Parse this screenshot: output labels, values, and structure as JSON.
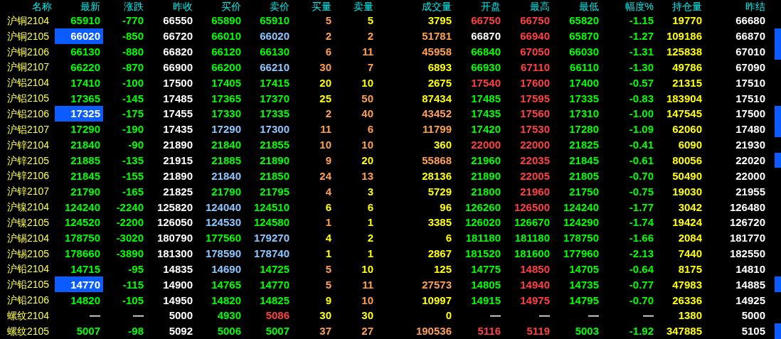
{
  "columns": [
    "名称",
    "最新",
    "涨跌",
    "昨收",
    "买价",
    "卖价",
    "买量",
    "卖量",
    "成交量",
    "开盘",
    "最高",
    "最低",
    "幅度%",
    "持仓量",
    "昨结"
  ],
  "rows": [
    {
      "name": "沪铜2104",
      "highlighted": false,
      "marked": false,
      "cells": [
        {
          "text": "65910",
          "color": "#00ff00"
        },
        {
          "text": "-770",
          "color": "#00ff00"
        },
        {
          "text": "66550",
          "color": "#ffffff"
        },
        {
          "text": "65890",
          "color": "#00ff00"
        },
        {
          "text": "65910",
          "color": "#00ff00"
        },
        {
          "text": "5",
          "color": "#ffa050"
        },
        {
          "text": "5",
          "color": "#ffff00"
        },
        {
          "text": "3795",
          "color": "#ffff00"
        },
        {
          "text": "66750",
          "color": "#ff4040"
        },
        {
          "text": "66750",
          "color": "#ff4040"
        },
        {
          "text": "65820",
          "color": "#00ff00"
        },
        {
          "text": "-1.15",
          "color": "#00ff00"
        },
        {
          "text": "19770",
          "color": "#ffff00"
        },
        {
          "text": "66680",
          "color": "#ffffff"
        }
      ]
    },
    {
      "name": "沪铜2105",
      "highlighted": true,
      "marked": true,
      "cells": [
        {
          "text": "66020",
          "color": "#ffffff"
        },
        {
          "text": "-850",
          "color": "#00ff00"
        },
        {
          "text": "66720",
          "color": "#ffffff"
        },
        {
          "text": "66010",
          "color": "#00ff00"
        },
        {
          "text": "66020",
          "color": "#8cc8ff"
        },
        {
          "text": "2",
          "color": "#ffa050"
        },
        {
          "text": "2",
          "color": "#ffa050"
        },
        {
          "text": "51781",
          "color": "#ffa050"
        },
        {
          "text": "66870",
          "color": "#ffffff"
        },
        {
          "text": "66940",
          "color": "#ff4040"
        },
        {
          "text": "65870",
          "color": "#00ff00"
        },
        {
          "text": "-1.27",
          "color": "#00ff00"
        },
        {
          "text": "109186",
          "color": "#ffff00"
        },
        {
          "text": "66870",
          "color": "#ffffff"
        }
      ]
    },
    {
      "name": "沪铜2106",
      "highlighted": false,
      "marked": true,
      "cells": [
        {
          "text": "66130",
          "color": "#00ff00"
        },
        {
          "text": "-880",
          "color": "#00ff00"
        },
        {
          "text": "66820",
          "color": "#ffffff"
        },
        {
          "text": "66120",
          "color": "#00ff00"
        },
        {
          "text": "66130",
          "color": "#00ff00"
        },
        {
          "text": "6",
          "color": "#ffa050"
        },
        {
          "text": "11",
          "color": "#ffa050"
        },
        {
          "text": "45958",
          "color": "#ffa050"
        },
        {
          "text": "66840",
          "color": "#00ff00"
        },
        {
          "text": "67050",
          "color": "#ff4040"
        },
        {
          "text": "66030",
          "color": "#00ff00"
        },
        {
          "text": "-1.31",
          "color": "#00ff00"
        },
        {
          "text": "125838",
          "color": "#ffff00"
        },
        {
          "text": "67010",
          "color": "#ffffff"
        }
      ]
    },
    {
      "name": "沪铜2107",
      "highlighted": false,
      "marked": false,
      "cells": [
        {
          "text": "66220",
          "color": "#00ff00"
        },
        {
          "text": "-870",
          "color": "#00ff00"
        },
        {
          "text": "66900",
          "color": "#ffffff"
        },
        {
          "text": "66200",
          "color": "#00ff00"
        },
        {
          "text": "66210",
          "color": "#8cc8ff"
        },
        {
          "text": "30",
          "color": "#ffa050"
        },
        {
          "text": "7",
          "color": "#ffa050"
        },
        {
          "text": "6893",
          "color": "#ffff00"
        },
        {
          "text": "66930",
          "color": "#00ff00"
        },
        {
          "text": "67110",
          "color": "#ff4040"
        },
        {
          "text": "66110",
          "color": "#00ff00"
        },
        {
          "text": "-1.30",
          "color": "#00ff00"
        },
        {
          "text": "49786",
          "color": "#ffff00"
        },
        {
          "text": "67090",
          "color": "#ffffff"
        }
      ]
    },
    {
      "name": "沪铝2104",
      "highlighted": false,
      "marked": false,
      "cells": [
        {
          "text": "17410",
          "color": "#00ff00"
        },
        {
          "text": "-100",
          "color": "#00ff00"
        },
        {
          "text": "17500",
          "color": "#ffffff"
        },
        {
          "text": "17405",
          "color": "#00ff00"
        },
        {
          "text": "17415",
          "color": "#00ff00"
        },
        {
          "text": "20",
          "color": "#ffff00"
        },
        {
          "text": "10",
          "color": "#ffff00"
        },
        {
          "text": "2675",
          "color": "#ffff00"
        },
        {
          "text": "17540",
          "color": "#ff4040"
        },
        {
          "text": "17600",
          "color": "#ff4040"
        },
        {
          "text": "17400",
          "color": "#00ff00"
        },
        {
          "text": "-0.57",
          "color": "#00ff00"
        },
        {
          "text": "21315",
          "color": "#ffff00"
        },
        {
          "text": "17510",
          "color": "#ffffff"
        }
      ]
    },
    {
      "name": "沪铝2105",
      "highlighted": false,
      "marked": false,
      "cells": [
        {
          "text": "17365",
          "color": "#00ff00"
        },
        {
          "text": "-145",
          "color": "#00ff00"
        },
        {
          "text": "17485",
          "color": "#ffffff"
        },
        {
          "text": "17365",
          "color": "#00ff00"
        },
        {
          "text": "17370",
          "color": "#00ff00"
        },
        {
          "text": "25",
          "color": "#ffff00"
        },
        {
          "text": "50",
          "color": "#ffa050"
        },
        {
          "text": "87434",
          "color": "#ffff00"
        },
        {
          "text": "17485",
          "color": "#00ff00"
        },
        {
          "text": "17595",
          "color": "#ff4040"
        },
        {
          "text": "17335",
          "color": "#00ff00"
        },
        {
          "text": "-0.83",
          "color": "#00ff00"
        },
        {
          "text": "183904",
          "color": "#ffff00"
        },
        {
          "text": "17510",
          "color": "#ffffff"
        }
      ]
    },
    {
      "name": "沪铝2106",
      "highlighted": true,
      "marked": true,
      "cells": [
        {
          "text": "17325",
          "color": "#ffffff"
        },
        {
          "text": "-175",
          "color": "#00ff00"
        },
        {
          "text": "17455",
          "color": "#ffffff"
        },
        {
          "text": "17330",
          "color": "#00ff00"
        },
        {
          "text": "17335",
          "color": "#00ff00"
        },
        {
          "text": "2",
          "color": "#ffa050"
        },
        {
          "text": "40",
          "color": "#ffa050"
        },
        {
          "text": "43452",
          "color": "#ffa050"
        },
        {
          "text": "17435",
          "color": "#00ff00"
        },
        {
          "text": "17560",
          "color": "#ff4040"
        },
        {
          "text": "17310",
          "color": "#00ff00"
        },
        {
          "text": "-1.00",
          "color": "#00ff00"
        },
        {
          "text": "147545",
          "color": "#ffff00"
        },
        {
          "text": "17500",
          "color": "#ffffff"
        }
      ]
    },
    {
      "name": "沪铝2107",
      "highlighted": false,
      "marked": true,
      "cells": [
        {
          "text": "17290",
          "color": "#00ff00"
        },
        {
          "text": "-190",
          "color": "#00ff00"
        },
        {
          "text": "17435",
          "color": "#ffffff"
        },
        {
          "text": "17290",
          "color": "#8cc8ff"
        },
        {
          "text": "17300",
          "color": "#8cc8ff"
        },
        {
          "text": "11",
          "color": "#ffa050"
        },
        {
          "text": "6",
          "color": "#ffa050"
        },
        {
          "text": "11799",
          "color": "#ffa050"
        },
        {
          "text": "17420",
          "color": "#00ff00"
        },
        {
          "text": "17530",
          "color": "#ff4040"
        },
        {
          "text": "17280",
          "color": "#00ff00"
        },
        {
          "text": "-1.09",
          "color": "#00ff00"
        },
        {
          "text": "62060",
          "color": "#ffff00"
        },
        {
          "text": "17480",
          "color": "#ffffff"
        }
      ]
    },
    {
      "name": "沪锌2104",
      "highlighted": false,
      "marked": false,
      "cells": [
        {
          "text": "21840",
          "color": "#00ff00"
        },
        {
          "text": "-90",
          "color": "#00ff00"
        },
        {
          "text": "21890",
          "color": "#ffffff"
        },
        {
          "text": "21840",
          "color": "#00ff00"
        },
        {
          "text": "21855",
          "color": "#00ff00"
        },
        {
          "text": "10",
          "color": "#ffa050"
        },
        {
          "text": "10",
          "color": "#ffa050"
        },
        {
          "text": "360",
          "color": "#ffff00"
        },
        {
          "text": "22000",
          "color": "#ff4040"
        },
        {
          "text": "22000",
          "color": "#ff4040"
        },
        {
          "text": "21825",
          "color": "#00ff00"
        },
        {
          "text": "-0.41",
          "color": "#00ff00"
        },
        {
          "text": "6090",
          "color": "#ffff00"
        },
        {
          "text": "21930",
          "color": "#ffffff"
        }
      ]
    },
    {
      "name": "沪锌2105",
      "highlighted": false,
      "marked": true,
      "cells": [
        {
          "text": "21885",
          "color": "#00ff00"
        },
        {
          "text": "-135",
          "color": "#00ff00"
        },
        {
          "text": "21915",
          "color": "#ffffff"
        },
        {
          "text": "21885",
          "color": "#00ff00"
        },
        {
          "text": "21890",
          "color": "#00ff00"
        },
        {
          "text": "9",
          "color": "#ffa050"
        },
        {
          "text": "20",
          "color": "#ffff00"
        },
        {
          "text": "55868",
          "color": "#ffa050"
        },
        {
          "text": "21960",
          "color": "#00ff00"
        },
        {
          "text": "22035",
          "color": "#ff4040"
        },
        {
          "text": "21845",
          "color": "#00ff00"
        },
        {
          "text": "-0.61",
          "color": "#00ff00"
        },
        {
          "text": "80056",
          "color": "#ffff00"
        },
        {
          "text": "22020",
          "color": "#ffffff"
        }
      ]
    },
    {
      "name": "沪锌2106",
      "highlighted": false,
      "marked": false,
      "cells": [
        {
          "text": "21845",
          "color": "#00ff00"
        },
        {
          "text": "-155",
          "color": "#00ff00"
        },
        {
          "text": "21890",
          "color": "#ffffff"
        },
        {
          "text": "21840",
          "color": "#8cc8ff"
        },
        {
          "text": "21850",
          "color": "#00ff00"
        },
        {
          "text": "24",
          "color": "#ffa050"
        },
        {
          "text": "13",
          "color": "#ffa050"
        },
        {
          "text": "28136",
          "color": "#ffff00"
        },
        {
          "text": "21890",
          "color": "#00ff00"
        },
        {
          "text": "22005",
          "color": "#ff4040"
        },
        {
          "text": "21805",
          "color": "#00ff00"
        },
        {
          "text": "-0.70",
          "color": "#00ff00"
        },
        {
          "text": "50490",
          "color": "#ffff00"
        },
        {
          "text": "22000",
          "color": "#ffffff"
        }
      ]
    },
    {
      "name": "沪锌2107",
      "highlighted": false,
      "marked": false,
      "cells": [
        {
          "text": "21790",
          "color": "#00ff00"
        },
        {
          "text": "-165",
          "color": "#00ff00"
        },
        {
          "text": "21825",
          "color": "#ffffff"
        },
        {
          "text": "21790",
          "color": "#00ff00"
        },
        {
          "text": "21795",
          "color": "#00ff00"
        },
        {
          "text": "4",
          "color": "#ffa050"
        },
        {
          "text": "3",
          "color": "#ffff00"
        },
        {
          "text": "5729",
          "color": "#ffff00"
        },
        {
          "text": "21800",
          "color": "#00ff00"
        },
        {
          "text": "21960",
          "color": "#ff4040"
        },
        {
          "text": "21750",
          "color": "#00ff00"
        },
        {
          "text": "-0.75",
          "color": "#00ff00"
        },
        {
          "text": "19030",
          "color": "#ffff00"
        },
        {
          "text": "21955",
          "color": "#ffffff"
        }
      ]
    },
    {
      "name": "沪镍2104",
      "highlighted": false,
      "marked": false,
      "cells": [
        {
          "text": "124240",
          "color": "#00ff00"
        },
        {
          "text": "-2240",
          "color": "#00ff00"
        },
        {
          "text": "125820",
          "color": "#ffffff"
        },
        {
          "text": "124040",
          "color": "#8cc8ff"
        },
        {
          "text": "124510",
          "color": "#00ff00"
        },
        {
          "text": "6",
          "color": "#ffff00"
        },
        {
          "text": "6",
          "color": "#ffff00"
        },
        {
          "text": "96",
          "color": "#ffff00"
        },
        {
          "text": "126260",
          "color": "#00ff00"
        },
        {
          "text": "126500",
          "color": "#ff4040"
        },
        {
          "text": "124240",
          "color": "#00ff00"
        },
        {
          "text": "-1.77",
          "color": "#00ff00"
        },
        {
          "text": "3042",
          "color": "#ffff00"
        },
        {
          "text": "126480",
          "color": "#ffffff"
        }
      ]
    },
    {
      "name": "沪镍2105",
      "highlighted": false,
      "marked": false,
      "cells": [
        {
          "text": "124520",
          "color": "#00ff00"
        },
        {
          "text": "-2200",
          "color": "#00ff00"
        },
        {
          "text": "126050",
          "color": "#ffffff"
        },
        {
          "text": "124530",
          "color": "#8cc8ff"
        },
        {
          "text": "124580",
          "color": "#00ff00"
        },
        {
          "text": "1",
          "color": "#ffa050"
        },
        {
          "text": "1",
          "color": "#ffff00"
        },
        {
          "text": "3385",
          "color": "#ffff00"
        },
        {
          "text": "126020",
          "color": "#00ff00"
        },
        {
          "text": "126670",
          "color": "#00ff00"
        },
        {
          "text": "124290",
          "color": "#00ff00"
        },
        {
          "text": "-1.74",
          "color": "#00ff00"
        },
        {
          "text": "19424",
          "color": "#ffff00"
        },
        {
          "text": "126720",
          "color": "#ffffff"
        }
      ]
    },
    {
      "name": "沪锡2104",
      "highlighted": false,
      "marked": false,
      "cells": [
        {
          "text": "178750",
          "color": "#00ff00"
        },
        {
          "text": "-3020",
          "color": "#00ff00"
        },
        {
          "text": "180790",
          "color": "#ffffff"
        },
        {
          "text": "177560",
          "color": "#00ff00"
        },
        {
          "text": "179270",
          "color": "#8cc8ff"
        },
        {
          "text": "4",
          "color": "#ffff00"
        },
        {
          "text": "2",
          "color": "#ffff00"
        },
        {
          "text": "6",
          "color": "#ffff00"
        },
        {
          "text": "181180",
          "color": "#00ff00"
        },
        {
          "text": "181180",
          "color": "#00ff00"
        },
        {
          "text": "178750",
          "color": "#00ff00"
        },
        {
          "text": "-1.66",
          "color": "#00ff00"
        },
        {
          "text": "2084",
          "color": "#ffff00"
        },
        {
          "text": "181770",
          "color": "#ffffff"
        }
      ]
    },
    {
      "name": "沪锡2105",
      "highlighted": false,
      "marked": false,
      "cells": [
        {
          "text": "178660",
          "color": "#00ff00"
        },
        {
          "text": "-3890",
          "color": "#00ff00"
        },
        {
          "text": "181300",
          "color": "#ffffff"
        },
        {
          "text": "178590",
          "color": "#8cc8ff"
        },
        {
          "text": "178740",
          "color": "#8cc8ff"
        },
        {
          "text": "1",
          "color": "#ffff00"
        },
        {
          "text": "1",
          "color": "#ffff00"
        },
        {
          "text": "2867",
          "color": "#ffff00"
        },
        {
          "text": "181520",
          "color": "#00ff00"
        },
        {
          "text": "181600",
          "color": "#00ff00"
        },
        {
          "text": "177960",
          "color": "#00ff00"
        },
        {
          "text": "-2.13",
          "color": "#00ff00"
        },
        {
          "text": "7440",
          "color": "#ffff00"
        },
        {
          "text": "182550",
          "color": "#ffffff"
        }
      ]
    },
    {
      "name": "沪铅2104",
      "highlighted": false,
      "marked": false,
      "cells": [
        {
          "text": "14715",
          "color": "#00ff00"
        },
        {
          "text": "-95",
          "color": "#00ff00"
        },
        {
          "text": "14835",
          "color": "#ffffff"
        },
        {
          "text": "14690",
          "color": "#8cc8ff"
        },
        {
          "text": "14725",
          "color": "#00ff00"
        },
        {
          "text": "5",
          "color": "#ffa050"
        },
        {
          "text": "10",
          "color": "#ffff00"
        },
        {
          "text": "125",
          "color": "#ffff00"
        },
        {
          "text": "14775",
          "color": "#00ff00"
        },
        {
          "text": "14850",
          "color": "#ff4040"
        },
        {
          "text": "14705",
          "color": "#00ff00"
        },
        {
          "text": "-0.64",
          "color": "#00ff00"
        },
        {
          "text": "8175",
          "color": "#ffff00"
        },
        {
          "text": "14810",
          "color": "#ffffff"
        }
      ]
    },
    {
      "name": "沪铅2105",
      "highlighted": true,
      "marked": true,
      "cells": [
        {
          "text": "14770",
          "color": "#ffffff"
        },
        {
          "text": "-115",
          "color": "#00ff00"
        },
        {
          "text": "14900",
          "color": "#ffffff"
        },
        {
          "text": "14765",
          "color": "#00ff00"
        },
        {
          "text": "14770",
          "color": "#00ff00"
        },
        {
          "text": "5",
          "color": "#ffa050"
        },
        {
          "text": "11",
          "color": "#ffa050"
        },
        {
          "text": "27573",
          "color": "#ffa050"
        },
        {
          "text": "14805",
          "color": "#00ff00"
        },
        {
          "text": "14940",
          "color": "#ff4040"
        },
        {
          "text": "14735",
          "color": "#00ff00"
        },
        {
          "text": "-0.77",
          "color": "#00ff00"
        },
        {
          "text": "47983",
          "color": "#ffff00"
        },
        {
          "text": "14885",
          "color": "#ffffff"
        }
      ]
    },
    {
      "name": "沪铅2106",
      "highlighted": false,
      "marked": false,
      "cells": [
        {
          "text": "14820",
          "color": "#00ff00"
        },
        {
          "text": "-105",
          "color": "#00ff00"
        },
        {
          "text": "14950",
          "color": "#ffffff"
        },
        {
          "text": "14820",
          "color": "#00ff00"
        },
        {
          "text": "14825",
          "color": "#00ff00"
        },
        {
          "text": "9",
          "color": "#ffff00"
        },
        {
          "text": "10",
          "color": "#ffa050"
        },
        {
          "text": "10997",
          "color": "#ffff00"
        },
        {
          "text": "14915",
          "color": "#00ff00"
        },
        {
          "text": "14975",
          "color": "#ff4040"
        },
        {
          "text": "14795",
          "color": "#00ff00"
        },
        {
          "text": "-0.70",
          "color": "#00ff00"
        },
        {
          "text": "26336",
          "color": "#ffff00"
        },
        {
          "text": "14925",
          "color": "#ffffff"
        }
      ]
    },
    {
      "name": "螺纹2104",
      "highlighted": false,
      "marked": false,
      "cells": [
        {
          "text": "—",
          "color": "#ffffff"
        },
        {
          "text": "—",
          "color": "#ffffff"
        },
        {
          "text": "5000",
          "color": "#ffffff"
        },
        {
          "text": "4930",
          "color": "#00ff00"
        },
        {
          "text": "5086",
          "color": "#ff4040"
        },
        {
          "text": "30",
          "color": "#ffff00"
        },
        {
          "text": "30",
          "color": "#ffff00"
        },
        {
          "text": "0",
          "color": "#ffff00"
        },
        {
          "text": "—",
          "color": "#ffffff"
        },
        {
          "text": "—",
          "color": "#ffffff"
        },
        {
          "text": "—",
          "color": "#ffffff"
        },
        {
          "text": "—",
          "color": "#ffffff"
        },
        {
          "text": "1380",
          "color": "#ffff00"
        },
        {
          "text": "5000",
          "color": "#ffffff"
        }
      ]
    },
    {
      "name": "螺纹2105",
      "highlighted": false,
      "marked": true,
      "cells": [
        {
          "text": "5007",
          "color": "#00ff00"
        },
        {
          "text": "-98",
          "color": "#00ff00"
        },
        {
          "text": "5092",
          "color": "#ffffff"
        },
        {
          "text": "5006",
          "color": "#00ff00"
        },
        {
          "text": "5007",
          "color": "#00ff00"
        },
        {
          "text": "37",
          "color": "#ffa050"
        },
        {
          "text": "27",
          "color": "#ffa050"
        },
        {
          "text": "190536",
          "color": "#ffa050"
        },
        {
          "text": "5116",
          "color": "#ff4040"
        },
        {
          "text": "5119",
          "color": "#ff4040"
        },
        {
          "text": "5003",
          "color": "#00ff00"
        },
        {
          "text": "-1.92",
          "color": "#00ff00"
        },
        {
          "text": "347885",
          "color": "#ffff00"
        },
        {
          "text": "5105",
          "color": "#ffffff"
        }
      ]
    }
  ]
}
